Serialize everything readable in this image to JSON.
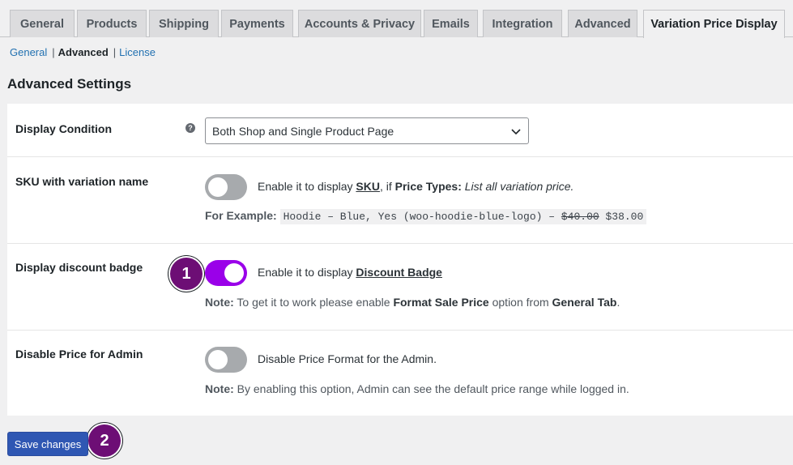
{
  "tabs": [
    {
      "label": "General"
    },
    {
      "label": "Products"
    },
    {
      "label": "Shipping"
    },
    {
      "label": "Payments"
    },
    {
      "label": "Accounts & Privacy"
    },
    {
      "label": "Emails"
    },
    {
      "label": "Integration"
    },
    {
      "label": "Advanced"
    },
    {
      "label": "Variation Price Display"
    }
  ],
  "subnav": {
    "general": "General",
    "advanced": "Advanced",
    "license": "License",
    "separator": "|"
  },
  "heading": "Advanced Settings",
  "rows": {
    "display_condition": {
      "label": "Display Condition",
      "help": "?",
      "select_value": "Both Shop and Single Product Page"
    },
    "sku": {
      "label": "SKU with variation name",
      "text_pre": "Enable it to display ",
      "text_sku": "SKU",
      "text_mid": ", if ",
      "text_price_types": "Price Types:",
      "text_list": " List all variation price.",
      "example_label": "For Example:",
      "example_code": "Hoodie – Blue, Yes (woo-hoodie-blue-logo) – ",
      "example_old_price": "$40.00",
      "example_new_price": " $38.00",
      "enabled": false
    },
    "discount_badge": {
      "label": "Display discount badge",
      "text_pre": "Enable it to display ",
      "text_link": "Discount Badge",
      "note_label": "Note:",
      "note_pre": " To get it to work please enable ",
      "note_bold1": "Format Sale Price",
      "note_mid": " option from ",
      "note_bold2": "General Tab",
      "note_end": ".",
      "enabled": true
    },
    "disable_admin": {
      "label": "Disable Price for Admin",
      "text": "Disable Price Format for the Admin.",
      "note_label": "Note:",
      "note_text": " By enabling this option, Admin can see the default price range while logged in.",
      "enabled": false
    }
  },
  "save_label": "Save changes",
  "markers": {
    "one": "1",
    "two": "2"
  },
  "colors": {
    "toggle_on": "#9a00e9",
    "toggle_off": "#a7aaad",
    "marker": "#6d0e75",
    "button": "#2f57b3",
    "link": "#2271b1"
  }
}
